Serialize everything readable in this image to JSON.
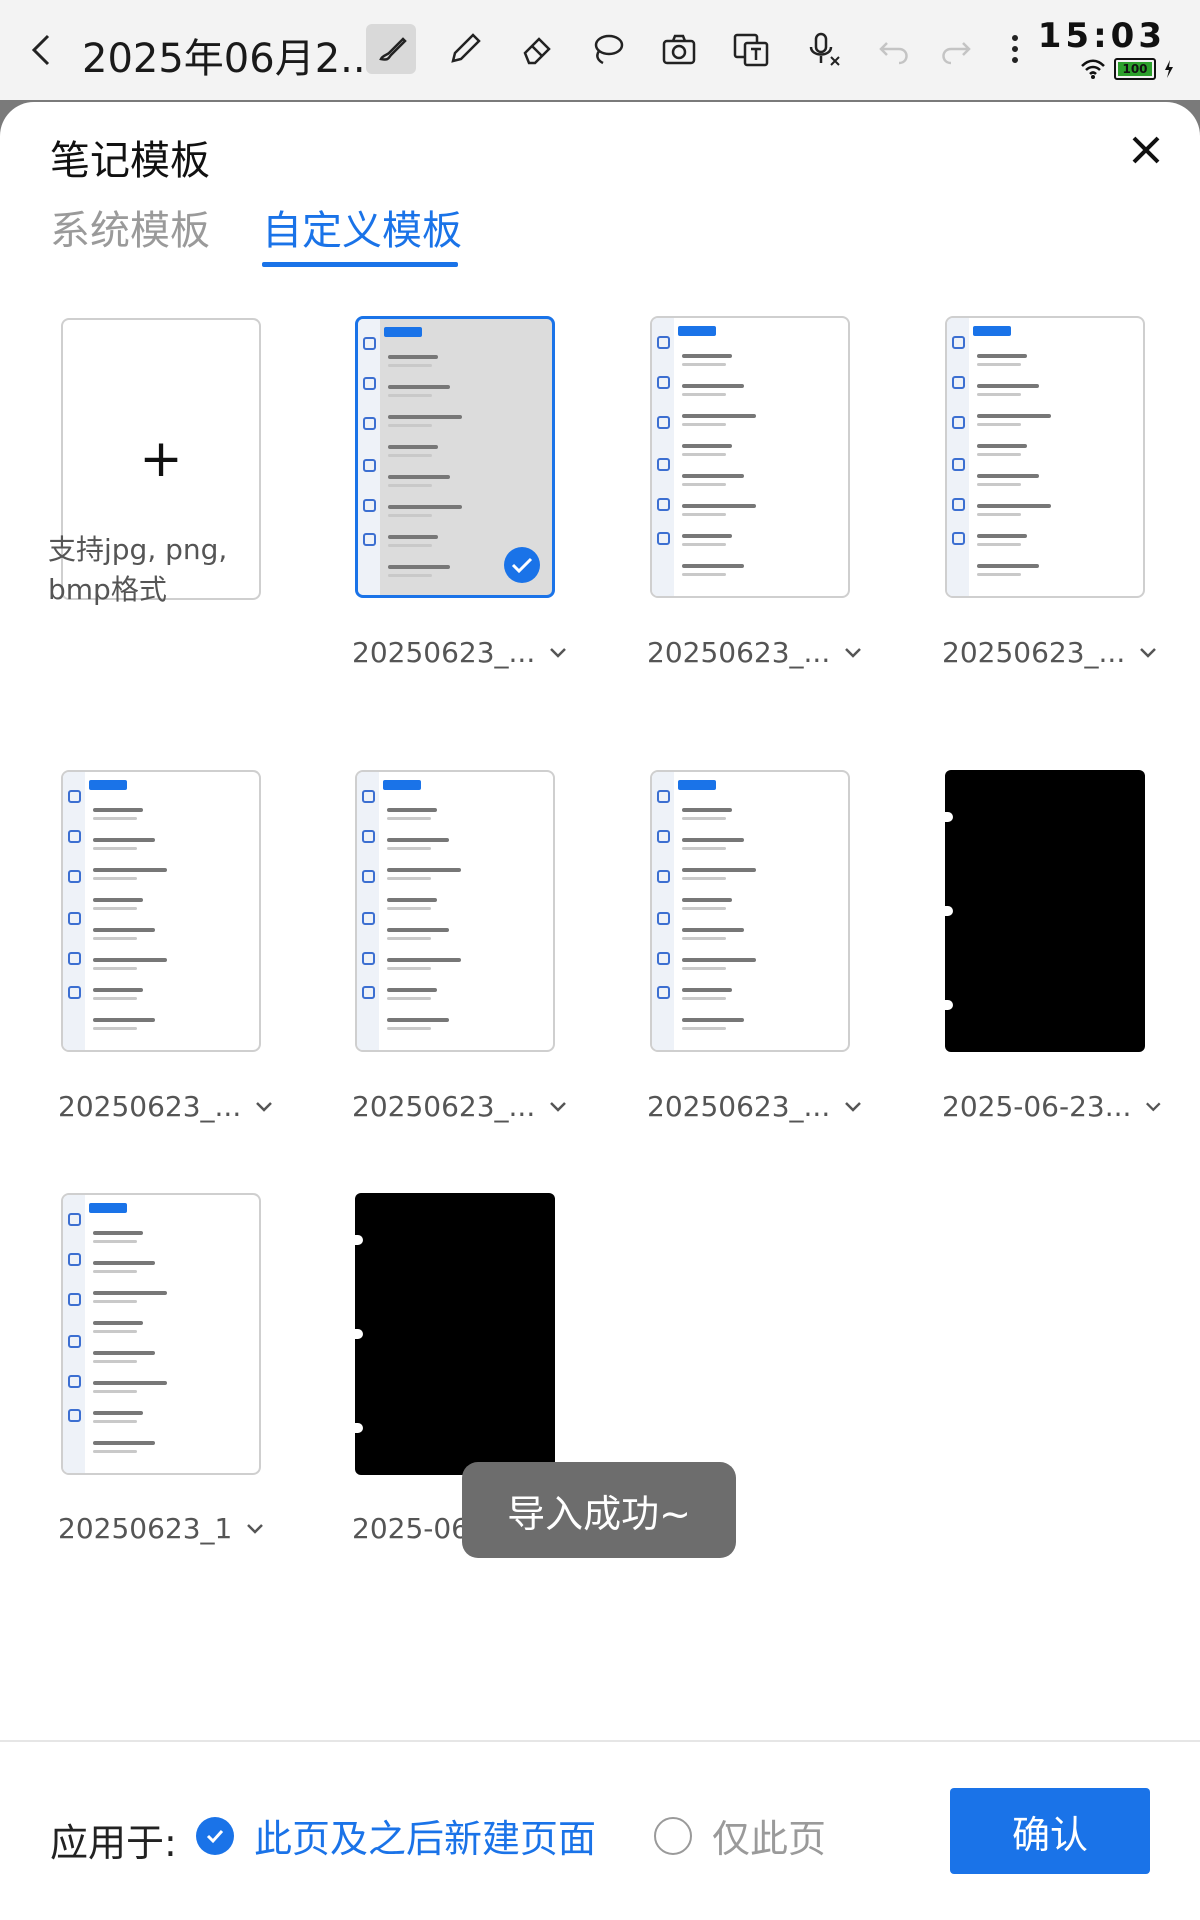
{
  "toolbar": {
    "title": "2025年06月2...",
    "tools": [
      "brush-icon",
      "pen-icon",
      "eraser-icon",
      "lasso-icon",
      "camera-icon",
      "translate-icon",
      "voice-input-icon",
      "undo-icon",
      "redo-icon",
      "more-icon"
    ],
    "active_tool": "brush-icon"
  },
  "status": {
    "time": "15:03",
    "battery": "100"
  },
  "sheet": {
    "title": "笔记模板",
    "tabs": [
      {
        "label": "系统模板",
        "active": false
      },
      {
        "label": "自定义模板",
        "active": true
      }
    ]
  },
  "add_card": {
    "hint": "支持jpg, png, bmp格式"
  },
  "templates": [
    {
      "label": "20250623_...",
      "kind": "screenshot",
      "selected": true
    },
    {
      "label": "20250623_...",
      "kind": "screenshot",
      "selected": false
    },
    {
      "label": "20250623_...",
      "kind": "screenshot",
      "selected": false
    },
    {
      "label": "20250623_...",
      "kind": "screenshot",
      "selected": false
    },
    {
      "label": "20250623_...",
      "kind": "screenshot",
      "selected": false
    },
    {
      "label": "20250623_...",
      "kind": "screenshot",
      "selected": false
    },
    {
      "label": "2025-06-23...",
      "kind": "black",
      "selected": false
    },
    {
      "label": "20250623_1",
      "kind": "screenshot",
      "selected": false
    },
    {
      "label": "2025-06-23...",
      "kind": "black",
      "selected": false
    }
  ],
  "toast": "导入成功~",
  "footer": {
    "apply_label": "应用于:",
    "option_all": "此页及之后新建页面",
    "option_this": "仅此页",
    "selected_option": "option_all",
    "confirm": "确认"
  },
  "colors": {
    "accent": "#1a73e8"
  }
}
